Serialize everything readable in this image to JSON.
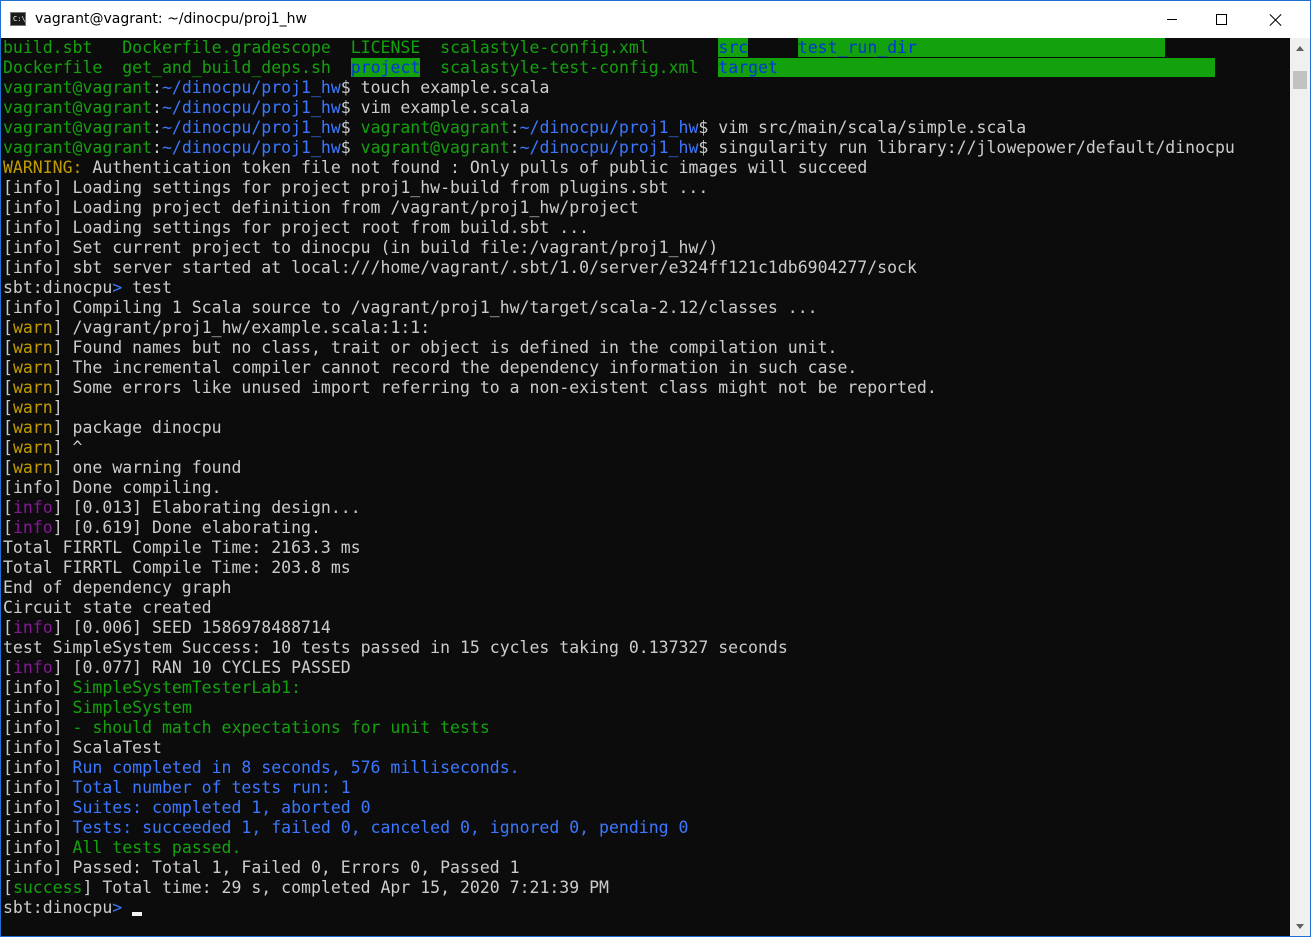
{
  "window": {
    "title": "vagrant@vagrant: ~/dinocpu/proj1_hw",
    "icon": "cmd-icon",
    "icon_text": "C:\\_"
  },
  "colors": {
    "default": "#cccccc",
    "prompt_user": "#13a10e",
    "prompt_path": "#3b78ff",
    "warn": "#c19c00",
    "info_purple": "#881798",
    "green_text": "#13a10e",
    "blue_text": "#3b78ff",
    "dir_highlight_bg": "#13a10e",
    "dir_highlight_fg": "#0037da",
    "bright": "#f2f2f2"
  },
  "terminal": {
    "lines": [
      [
        {
          "t": "build.sbt   ",
          "c": "#13a10e"
        },
        {
          "t": "Dockerfile.gradescope",
          "c": "#13a10e"
        },
        {
          "t": "  ",
          "c": "#cccccc"
        },
        {
          "t": "LICENSE",
          "c": "#13a10e"
        },
        {
          "t": "  ",
          "c": "#cccccc"
        },
        {
          "t": "scalastyle-config.xml",
          "c": "#13a10e"
        },
        {
          "t": "       ",
          "c": "#cccccc"
        },
        {
          "t": "src",
          "c": "#0037da",
          "bg": "#13a10e"
        },
        {
          "t": "     ",
          "c": "#0c0c0c",
          "bg": "#0c0c0c"
        },
        {
          "t": "test_run_dir",
          "c": "#0037da",
          "bg": "#13a10e"
        },
        {
          "t": "                         ",
          "c": "#cccccc",
          "bg": "#13a10e"
        }
      ],
      [
        {
          "t": "Dockerfile  ",
          "c": "#13a10e"
        },
        {
          "t": "get_and_build_deps.sh",
          "c": "#13a10e"
        },
        {
          "t": "  ",
          "c": "#cccccc"
        },
        {
          "t": "project",
          "c": "#0037da",
          "bg": "#13a10e"
        },
        {
          "t": "  ",
          "c": "#cccccc"
        },
        {
          "t": "scalastyle-test-config.xml",
          "c": "#13a10e"
        },
        {
          "t": "  ",
          "c": "#cccccc"
        },
        {
          "t": "target",
          "c": "#0037da",
          "bg": "#13a10e"
        },
        {
          "t": "                                            ",
          "c": "#cccccc",
          "bg": "#13a10e"
        }
      ],
      [
        {
          "t": "vagrant@vagrant",
          "c": "#13a10e"
        },
        {
          "t": ":",
          "c": "#cccccc"
        },
        {
          "t": "~/dinocpu/proj1_hw",
          "c": "#3b78ff"
        },
        {
          "t": "$ touch example.scala",
          "c": "#cccccc"
        }
      ],
      [
        {
          "t": "vagrant@vagrant",
          "c": "#13a10e"
        },
        {
          "t": ":",
          "c": "#cccccc"
        },
        {
          "t": "~/dinocpu/proj1_hw",
          "c": "#3b78ff"
        },
        {
          "t": "$ vim example.scala",
          "c": "#cccccc"
        }
      ],
      [
        {
          "t": "vagrant@vagrant",
          "c": "#13a10e"
        },
        {
          "t": ":",
          "c": "#cccccc"
        },
        {
          "t": "~/dinocpu/proj1_hw",
          "c": "#3b78ff"
        },
        {
          "t": "$ ",
          "c": "#cccccc"
        },
        {
          "t": "vagrant@vagrant",
          "c": "#13a10e"
        },
        {
          "t": ":",
          "c": "#cccccc"
        },
        {
          "t": "~/dinocpu/proj1_hw",
          "c": "#3b78ff"
        },
        {
          "t": "$ vim src/main/scala/simple.scala",
          "c": "#cccccc"
        }
      ],
      [
        {
          "t": "vagrant@vagrant",
          "c": "#13a10e"
        },
        {
          "t": ":",
          "c": "#cccccc"
        },
        {
          "t": "~/dinocpu/proj1_hw",
          "c": "#3b78ff"
        },
        {
          "t": "$ ",
          "c": "#cccccc"
        },
        {
          "t": "vagrant@vagrant",
          "c": "#13a10e"
        },
        {
          "t": ":",
          "c": "#cccccc"
        },
        {
          "t": "~/dinocpu/proj1_hw",
          "c": "#3b78ff"
        },
        {
          "t": "$ singularity run library://jlowepower/default/dinocpu",
          "c": "#cccccc"
        }
      ],
      [
        {
          "t": "WARNING:",
          "c": "#c19c00"
        },
        {
          "t": " Authentication token file not found : Only pulls of public images will succeed",
          "c": "#cccccc"
        }
      ],
      [
        {
          "t": "[info] Loading settings for project proj1_hw-build from plugins.sbt ...",
          "c": "#cccccc"
        }
      ],
      [
        {
          "t": "[info] Loading project definition from /vagrant/proj1_hw/project",
          "c": "#cccccc"
        }
      ],
      [
        {
          "t": "[info] Loading settings for project root from build.sbt ...",
          "c": "#cccccc"
        }
      ],
      [
        {
          "t": "[info] Set current project to dinocpu (in build file:/vagrant/proj1_hw/)",
          "c": "#cccccc"
        }
      ],
      [
        {
          "t": "[info] sbt server started at local:///home/vagrant/.sbt/1.0/server/e324ff121c1db6904277/sock",
          "c": "#cccccc"
        }
      ],
      [
        {
          "t": "sbt:dinocpu",
          "c": "#cccccc"
        },
        {
          "t": "> ",
          "c": "#3b78ff"
        },
        {
          "t": "test",
          "c": "#cccccc"
        }
      ],
      [
        {
          "t": "[info] Compiling 1 Scala source to /vagrant/proj1_hw/target/scala-2.12/classes ...",
          "c": "#cccccc"
        }
      ],
      [
        {
          "t": "[",
          "c": "#cccccc"
        },
        {
          "t": "warn",
          "c": "#c19c00"
        },
        {
          "t": "] /vagrant/proj1_hw/example.scala:1:1:",
          "c": "#cccccc"
        }
      ],
      [
        {
          "t": "[",
          "c": "#cccccc"
        },
        {
          "t": "warn",
          "c": "#c19c00"
        },
        {
          "t": "] Found names but no class, trait or object is defined in the compilation unit.",
          "c": "#cccccc"
        }
      ],
      [
        {
          "t": "[",
          "c": "#cccccc"
        },
        {
          "t": "warn",
          "c": "#c19c00"
        },
        {
          "t": "] The incremental compiler cannot record the dependency information in such case.",
          "c": "#cccccc"
        }
      ],
      [
        {
          "t": "[",
          "c": "#cccccc"
        },
        {
          "t": "warn",
          "c": "#c19c00"
        },
        {
          "t": "] Some errors like unused import referring to a non-existent class might not be reported.",
          "c": "#cccccc"
        }
      ],
      [
        {
          "t": "[",
          "c": "#cccccc"
        },
        {
          "t": "warn",
          "c": "#c19c00"
        },
        {
          "t": "]",
          "c": "#cccccc"
        }
      ],
      [
        {
          "t": "[",
          "c": "#cccccc"
        },
        {
          "t": "warn",
          "c": "#c19c00"
        },
        {
          "t": "] package dinocpu",
          "c": "#cccccc"
        }
      ],
      [
        {
          "t": "[",
          "c": "#cccccc"
        },
        {
          "t": "warn",
          "c": "#c19c00"
        },
        {
          "t": "] ^",
          "c": "#cccccc"
        }
      ],
      [
        {
          "t": "[",
          "c": "#cccccc"
        },
        {
          "t": "warn",
          "c": "#c19c00"
        },
        {
          "t": "] one warning found",
          "c": "#cccccc"
        }
      ],
      [
        {
          "t": "[info] Done compiling.",
          "c": "#cccccc"
        }
      ],
      [
        {
          "t": "[",
          "c": "#cccccc"
        },
        {
          "t": "info",
          "c": "#881798"
        },
        {
          "t": "] [0.013] Elaborating design...",
          "c": "#cccccc"
        }
      ],
      [
        {
          "t": "[",
          "c": "#cccccc"
        },
        {
          "t": "info",
          "c": "#881798"
        },
        {
          "t": "] [0.619] Done elaborating.",
          "c": "#cccccc"
        }
      ],
      [
        {
          "t": "Total FIRRTL Compile Time: 2163.3 ms",
          "c": "#cccccc"
        }
      ],
      [
        {
          "t": "Total FIRRTL Compile Time: 203.8 ms",
          "c": "#cccccc"
        }
      ],
      [
        {
          "t": "End of dependency graph",
          "c": "#cccccc"
        }
      ],
      [
        {
          "t": "Circuit state created",
          "c": "#cccccc"
        }
      ],
      [
        {
          "t": "[",
          "c": "#cccccc"
        },
        {
          "t": "info",
          "c": "#881798"
        },
        {
          "t": "] [0.006] SEED 1586978488714",
          "c": "#cccccc"
        }
      ],
      [
        {
          "t": "test SimpleSystem Success: 10 tests passed in 15 cycles taking 0.137327 seconds",
          "c": "#cccccc"
        }
      ],
      [
        {
          "t": "[",
          "c": "#cccccc"
        },
        {
          "t": "info",
          "c": "#881798"
        },
        {
          "t": "] [0.077] RAN 10 CYCLES PASSED",
          "c": "#cccccc"
        }
      ],
      [
        {
          "t": "[info] ",
          "c": "#cccccc"
        },
        {
          "t": "SimpleSystemTesterLab1:",
          "c": "#13a10e"
        }
      ],
      [
        {
          "t": "[info] ",
          "c": "#cccccc"
        },
        {
          "t": "SimpleSystem",
          "c": "#13a10e"
        }
      ],
      [
        {
          "t": "[info] ",
          "c": "#cccccc"
        },
        {
          "t": "- should match expectations for unit tests",
          "c": "#13a10e"
        }
      ],
      [
        {
          "t": "[info] ScalaTest",
          "c": "#cccccc"
        }
      ],
      [
        {
          "t": "[info] ",
          "c": "#cccccc"
        },
        {
          "t": "Run completed in 8 seconds, 576 milliseconds.",
          "c": "#3b78ff"
        }
      ],
      [
        {
          "t": "[info] ",
          "c": "#cccccc"
        },
        {
          "t": "Total number of tests run: 1",
          "c": "#3b78ff"
        }
      ],
      [
        {
          "t": "[info] ",
          "c": "#cccccc"
        },
        {
          "t": "Suites: completed 1, aborted 0",
          "c": "#3b78ff"
        }
      ],
      [
        {
          "t": "[info] ",
          "c": "#cccccc"
        },
        {
          "t": "Tests: succeeded 1, failed 0, canceled 0, ignored 0, pending 0",
          "c": "#3b78ff"
        }
      ],
      [
        {
          "t": "[info] ",
          "c": "#cccccc"
        },
        {
          "t": "All tests passed.",
          "c": "#13a10e"
        }
      ],
      [
        {
          "t": "[info] Passed: Total 1, Failed 0, Errors 0, Passed 1",
          "c": "#cccccc"
        }
      ],
      [
        {
          "t": "[",
          "c": "#cccccc"
        },
        {
          "t": "success",
          "c": "#13a10e"
        },
        {
          "t": "] Total time: 29 s, completed Apr 15, 2020 7:21:39 PM",
          "c": "#cccccc"
        }
      ],
      [
        {
          "t": "sbt:dinocpu",
          "c": "#cccccc"
        },
        {
          "t": "> ",
          "c": "#3b78ff"
        }
      ]
    ]
  }
}
